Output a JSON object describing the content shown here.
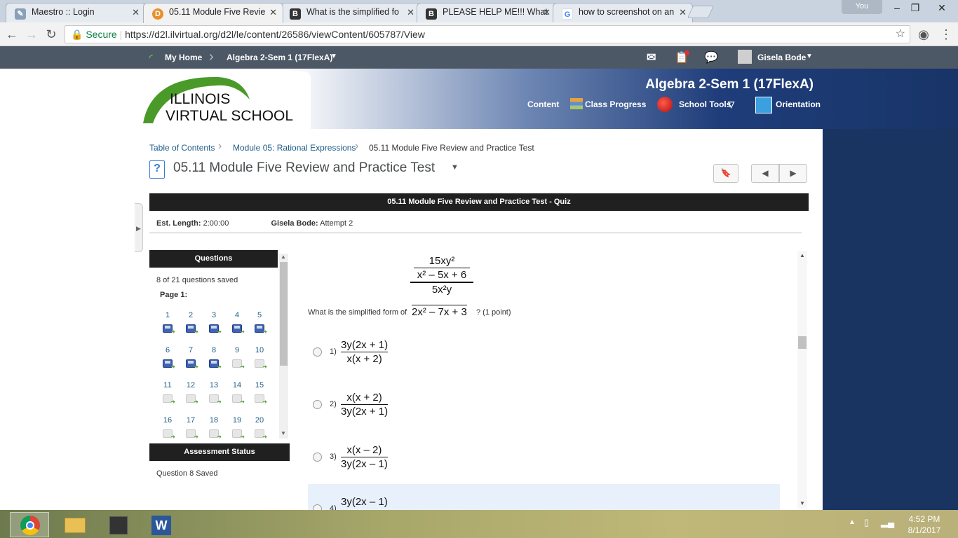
{
  "browser": {
    "tabs": [
      {
        "title": "Maestro :: Login",
        "fav": "hat-icon"
      },
      {
        "title": "05.11 Module Five Revie",
        "fav": "d2l-icon",
        "active": true
      },
      {
        "title": "What is the simplified fo",
        "fav": "brainly-icon"
      },
      {
        "title": "PLEASE HELP ME!!! What",
        "fav": "brainly-icon"
      },
      {
        "title": "how to screenshot on an",
        "fav": "google-icon"
      }
    ],
    "profile": "You",
    "secure_label": "Secure",
    "url": "https://d2l.ilvirtual.org/d2l/le/content/26586/viewContent/605787/View"
  },
  "d2l_nav": {
    "home": "My Home",
    "course": "Algebra 2-Sem 1 (17FlexA)",
    "user": "Gisela Bode"
  },
  "banner": {
    "school_line1": "ILLINOIS",
    "school_line2": "VIRTUAL SCHOOL",
    "course_title": "Algebra 2-Sem 1 (17FlexA)",
    "nav": [
      "Content",
      "Class Progress",
      "School Tools",
      "Orientation"
    ]
  },
  "breadcrumb": [
    "Table of Contents",
    "Module 05: Rational Expressions",
    "05.11 Module Five Review and Practice Test"
  ],
  "page_title": "05.11 Module Five Review and Practice Test",
  "quiz_bar": "05.11 Module Five Review and Practice Test - Quiz",
  "meta": {
    "est_label": "Est. Length:",
    "est_value": "2:00:00",
    "attempt_label": "Gisela Bode:",
    "attempt_value": "Attempt 2"
  },
  "questions_panel": {
    "header": "Questions",
    "saved_text": "8 of 21 questions saved",
    "page_label": "Page 1:",
    "items": [
      {
        "n": "1",
        "saved": true
      },
      {
        "n": "2",
        "saved": true
      },
      {
        "n": "3",
        "saved": true
      },
      {
        "n": "4",
        "saved": true
      },
      {
        "n": "5",
        "saved": true
      },
      {
        "n": "6",
        "saved": true
      },
      {
        "n": "7",
        "saved": true
      },
      {
        "n": "8",
        "saved": true
      },
      {
        "n": "9",
        "saved": false
      },
      {
        "n": "10",
        "saved": false
      },
      {
        "n": "11",
        "saved": false
      },
      {
        "n": "12",
        "saved": false
      },
      {
        "n": "13",
        "saved": false
      },
      {
        "n": "14",
        "saved": false
      },
      {
        "n": "15",
        "saved": false
      },
      {
        "n": "16",
        "saved": false
      },
      {
        "n": "17",
        "saved": false
      },
      {
        "n": "18",
        "saved": false
      },
      {
        "n": "19",
        "saved": false
      },
      {
        "n": "20",
        "saved": false
      }
    ]
  },
  "assessment_status": {
    "header": "Assessment Status",
    "text": "Question 8 Saved"
  },
  "question": {
    "top_num": "15xy²",
    "top_den": "x² – 5x + 6",
    "bot_num": "5x²y",
    "bot_den": "2x² – 7x + 3",
    "prompt": "What is the simplified form of",
    "points": "? (1 point)",
    "options": [
      {
        "label": "1)",
        "num": "3y(2x + 1)",
        "den": "x(x + 2)"
      },
      {
        "label": "2)",
        "num": "x(x + 2)",
        "den": "3y(2x + 1)"
      },
      {
        "label": "3)",
        "num": "x(x – 2)",
        "den": "3y(2x – 1)"
      },
      {
        "label": "4)",
        "num": "3y(2x – 1)",
        "den": ""
      }
    ]
  },
  "taskbar": {
    "time": "4:52 PM",
    "date": "8/1/2017"
  }
}
